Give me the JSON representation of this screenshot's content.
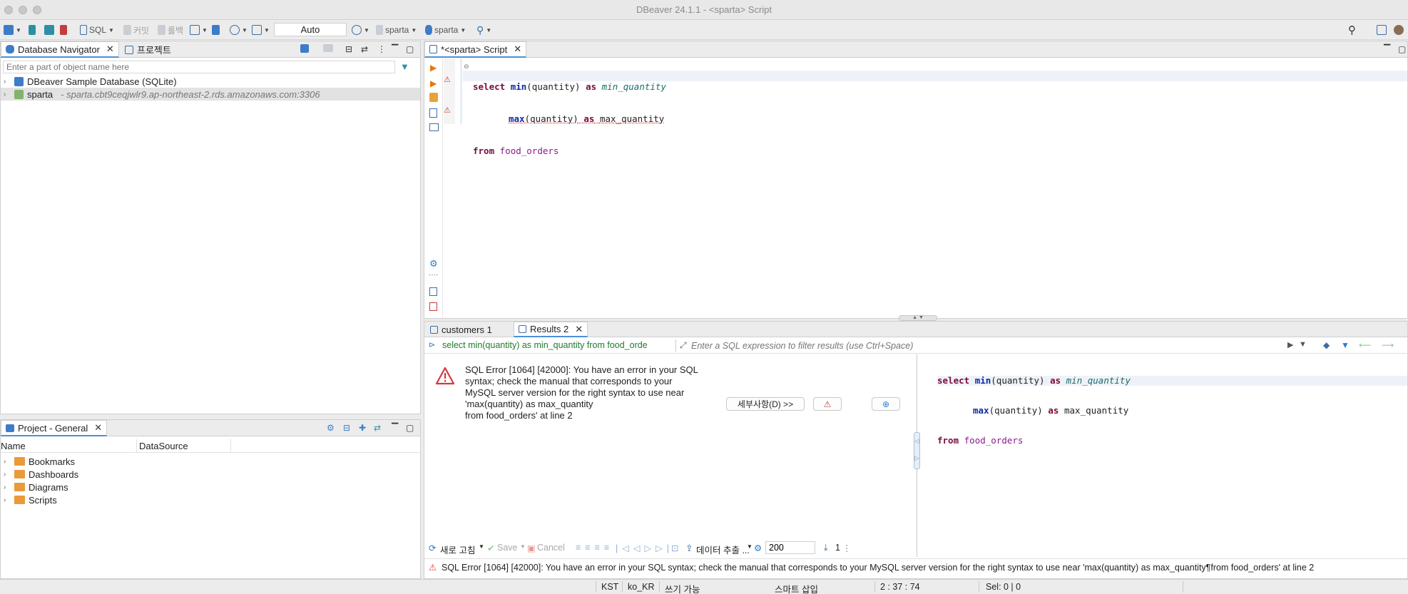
{
  "window": {
    "title": "DBeaver 24.1.1 - <sparta> Script"
  },
  "toolbar": {
    "sql_label": "SQL",
    "commit_label": "커밋",
    "rollback_label": "롤백",
    "transaction_mode": "Auto",
    "connection_label": "sparta",
    "schema_label": "sparta"
  },
  "navigator": {
    "tab_label": "Database Navigator",
    "projects_tab_label": "프로젝트",
    "filter_placeholder": "Enter a part of object name here",
    "items": [
      {
        "label": "DBeaver Sample Database (SQLite)",
        "detail": ""
      },
      {
        "label": "sparta",
        "detail": "- sparta.cbt9ceqjwlr9.ap-northeast-2.rds.amazonaws.com:3306"
      }
    ]
  },
  "project": {
    "tab_label": "Project - General",
    "columns": [
      "Name",
      "DataSource"
    ],
    "items": [
      "Bookmarks",
      "Dashboards",
      "Diagrams",
      "Scripts"
    ]
  },
  "editor": {
    "tab_label": "*<sparta> Script",
    "lines": [
      {
        "kw": "select",
        "fn": "min",
        "arg": "(quantity)",
        "as": "as",
        "alias": "min_quantity"
      },
      {
        "kw": "",
        "fn": "max",
        "arg": "(quantity)",
        "as": "as",
        "alias": "max_quantity"
      },
      {
        "kw": "from",
        "fn": "",
        "arg": "",
        "as": "",
        "alias": "food_orders"
      }
    ]
  },
  "results": {
    "tabs": [
      "customers 1",
      "Results 2"
    ],
    "query_summary": "select min(quantity) as min_quantity from food_orde",
    "filter_placeholder": "Enter a SQL expression to filter results (use Ctrl+Space)",
    "error_message": "SQL Error [1064] [42000]: You have an error in your SQL syntax; check the manual that corresponds to your MySQL server version for the right syntax to use near 'max(quantity) as max_quantity from food_orders' at line 2",
    "error_lines": [
      "SQL Error [1064] [42000]: You have an error in your SQL",
      "syntax; check the manual that corresponds to your",
      "MySQL server version for the right syntax to use near",
      "'max(quantity) as max_quantity",
      "from food_orders' at line 2"
    ],
    "details_button": "세부사항(D) >>",
    "bottom_bar": {
      "refresh_label": "새로 고침",
      "save_label": "Save",
      "cancel_label": "Cancel",
      "export_label": "데이터 추출 ...",
      "fetch_size": "200",
      "row_count": "1"
    },
    "status_error": "SQL Error [1064] [42000]: You have an error in your SQL syntax; check the manual that corresponds to your MySQL server version for the right syntax to use near 'max(quantity) as max_quantity¶from food_orders' at line 2"
  },
  "statusbar": {
    "timezone": "KST",
    "locale": "ko_KR",
    "write_mode": "쓰기 가능",
    "insert_mode": "스마트 삽입",
    "cursor_position": "2 : 37 : 74",
    "selection": "Sel: 0 | 0"
  }
}
